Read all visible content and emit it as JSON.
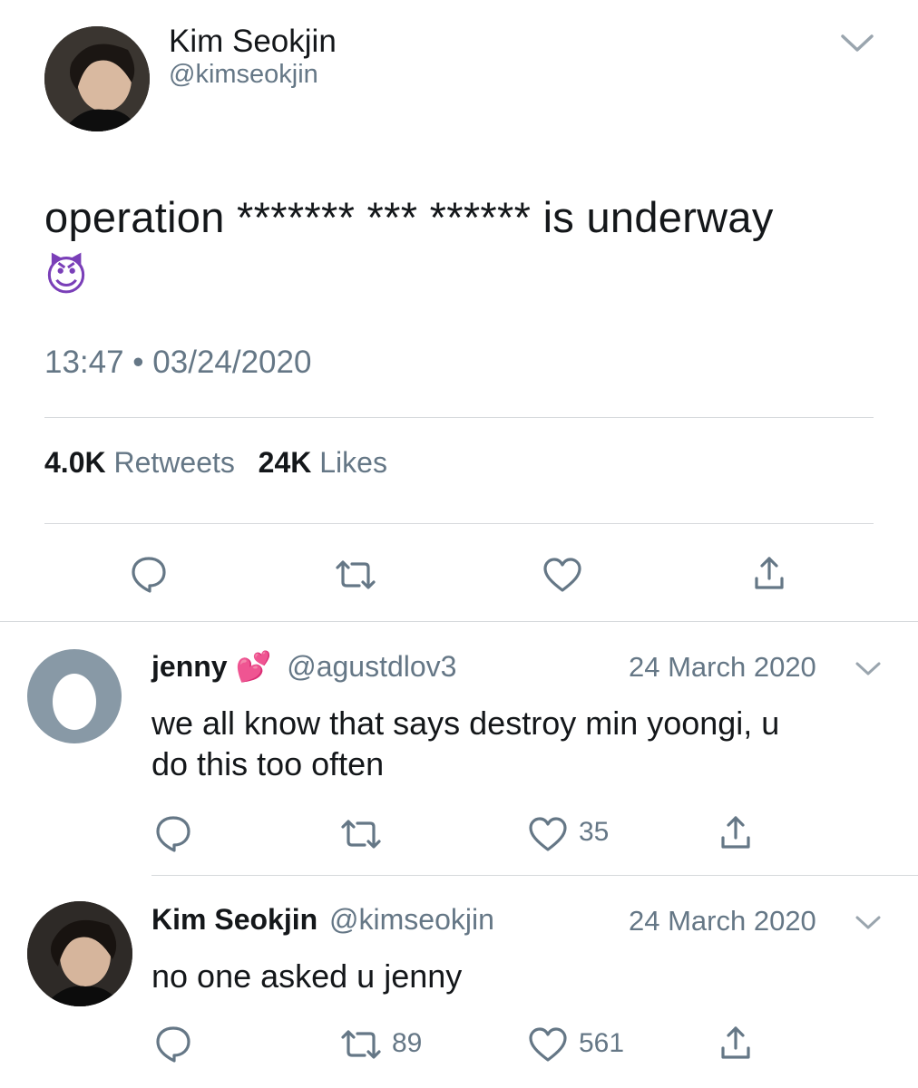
{
  "main_tweet": {
    "author_name": "Kim Seokjin",
    "author_handle": "@kimseokjin",
    "text": "operation ******* *** ****** is underway",
    "emoji": "😈",
    "timestamp": "13:47 • 03/24/2020",
    "retweets_count": "4.0K",
    "retweets_label": "Retweets",
    "likes_count": "24K",
    "likes_label": "Likes"
  },
  "replies": [
    {
      "author_name": "jenny",
      "author_emoji": "💕",
      "author_handle": "@agustdlov3",
      "date": "24 March 2020",
      "text_line1": "we all know that says destroy min yoongi, u",
      "text_line2": "do this too often",
      "retweets": "",
      "likes": "35"
    },
    {
      "author_name": "Kim Seokjin",
      "author_handle": "@kimseokjin",
      "date": "24 March 2020",
      "text_line1": "no one asked u jenny",
      "retweets": "89",
      "likes": "561"
    }
  ],
  "icons": {
    "reply": "reply-icon",
    "retweet": "retweet-icon",
    "like": "heart-icon",
    "share": "share-icon",
    "more": "chevron-down-icon"
  },
  "colors": {
    "text": "#14171a",
    "secondary": "#657786",
    "divider": "#d6d9dc",
    "egg_avatar": "#8899a6"
  }
}
